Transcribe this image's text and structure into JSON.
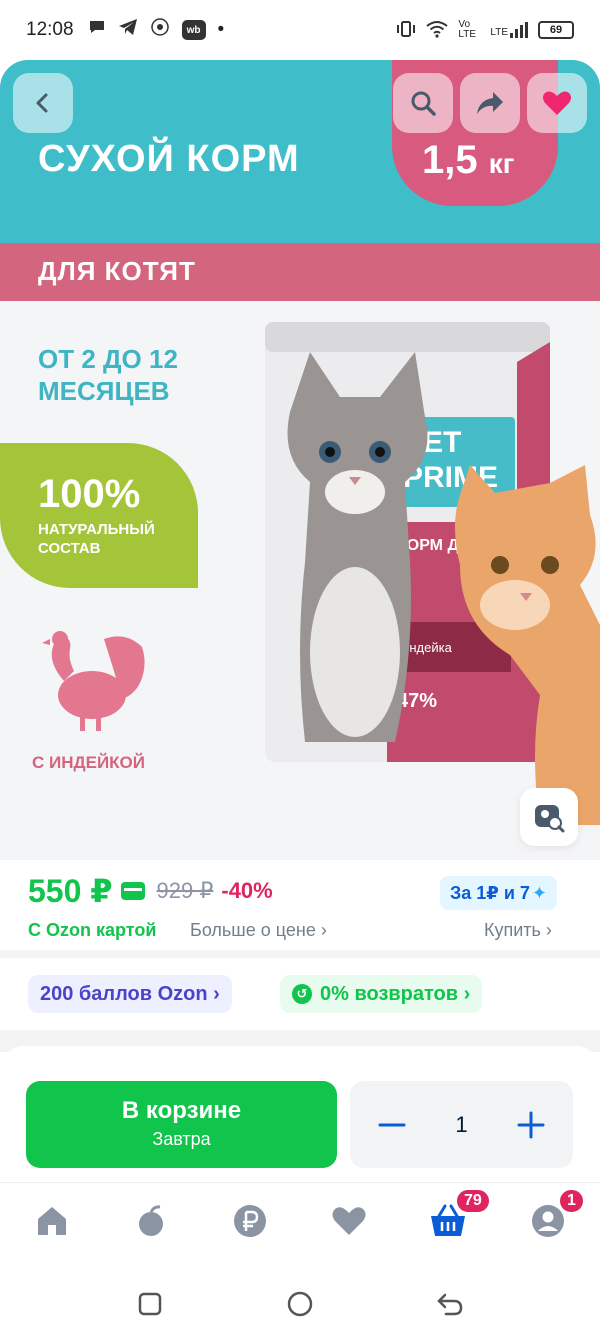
{
  "status_bar": {
    "time": "12:08",
    "volte": "Vo LTE",
    "lte": "LTE",
    "battery": "69"
  },
  "product_image": {
    "banner_title": "СУХОЙ КОРМ",
    "weight_number": "1,5",
    "weight_unit": "кг",
    "band_text": "ДЛЯ КОТЯТ",
    "age_line1": "ОТ 2 ДО 12",
    "age_line2": "МЕСЯЦЕВ",
    "natural_percent": "100%",
    "natural_line1": "НАТУРАЛЬНЫЙ",
    "natural_line2": "СОСТАВ",
    "turkey_label": "С ИНДЕЙКОЙ",
    "pack_brand_line1": "PET",
    "pack_brand_line2": "PRIME",
    "pack_label": "КОРМ ДЛЯ КО",
    "pack_flavor": "Индейка",
    "pack_percent": "47%"
  },
  "price": {
    "current": "550 ₽",
    "old": "929 ₽",
    "discount": "-40%",
    "installment": "За 1₽ и 7",
    "ozon_card": "С Ozon картой",
    "more_about_price": "Больше о цене ›",
    "buy": "Купить ›"
  },
  "chips": {
    "points": "200 баллов Ozon ›",
    "returns": "0% возвратов ›"
  },
  "cart": {
    "button_title": "В корзине",
    "button_subtitle": "Завтра",
    "quantity": "1"
  },
  "bottom_nav": {
    "cart_badge": "79",
    "profile_badge": "1"
  },
  "colors": {
    "accent_green": "#10c44c",
    "discount_red": "#e0245e",
    "banner_teal": "#3fbdc9",
    "banner_pink": "#d4657f",
    "nav_blue": "#0a5dd6"
  }
}
